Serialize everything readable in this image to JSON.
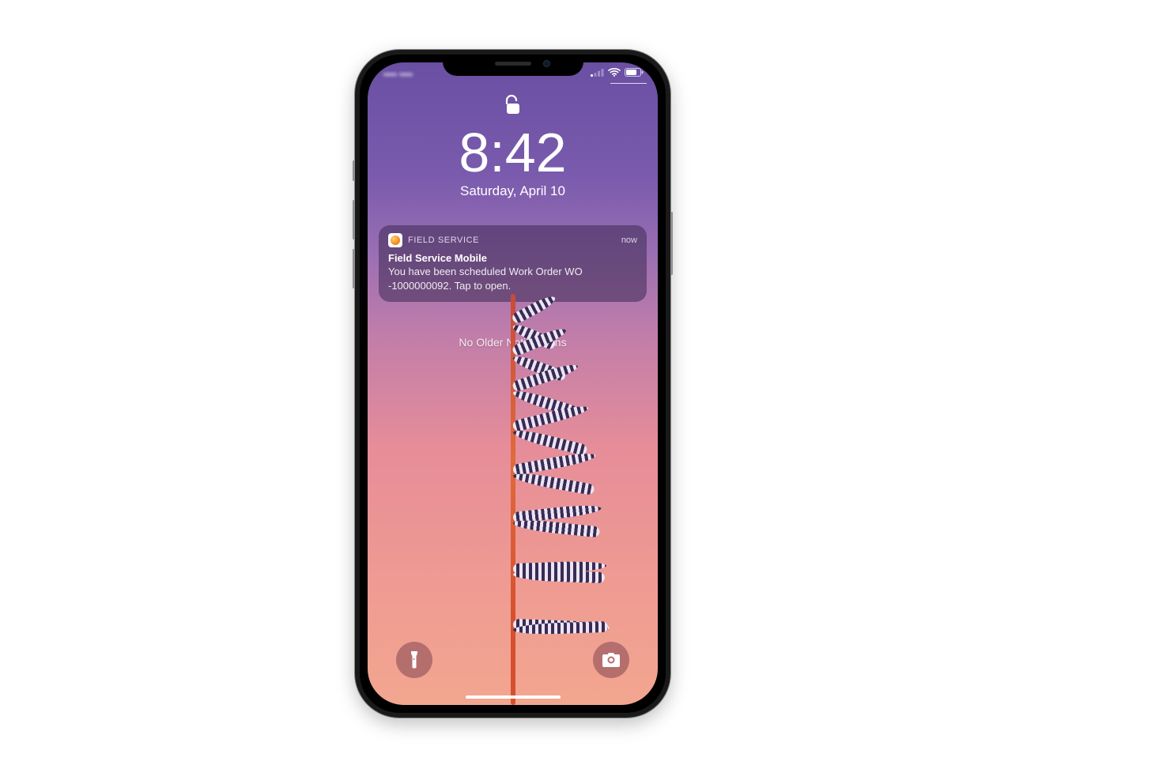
{
  "status": {
    "carrier": "•••• ••••"
  },
  "lock": {
    "time": "8:42",
    "date": "Saturday, April 10"
  },
  "notification": {
    "app_name": "FIELD SERVICE",
    "when": "now",
    "title": "Field Service Mobile",
    "body": "You have been scheduled Work Order WO -1000000092. Tap to open."
  },
  "older_label": "No Older Notifications"
}
